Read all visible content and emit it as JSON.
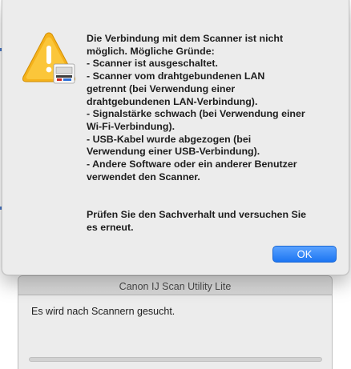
{
  "alert": {
    "icon": "warning-scanner-icon",
    "message_lines": [
      "Die Verbindung mit dem Scanner ist nicht",
      "möglich. Mögliche Gründe:",
      "- Scanner ist ausgeschaltet.",
      "- Scanner vom drahtgebundenen LAN",
      "getrennt (bei Verwendung einer",
      "drahtgebundenen LAN-Verbindung).",
      "- Signalstärke schwach (bei Verwendung einer",
      "Wi-Fi-Verbindung).",
      "- USB-Kabel wurde abgezogen (bei",
      "Verwendung einer USB-Verbindung).",
      "- Andere Software oder ein anderer Benutzer",
      "verwendet den Scanner."
    ],
    "instruction_lines": [
      "Prüfen Sie den Sachverhalt und versuchen Sie",
      "es erneut."
    ],
    "ok_label": "OK"
  },
  "window": {
    "title": "Canon IJ Scan Utility Lite",
    "status": "Es wird nach Scannern gesucht.",
    "progress": 0
  },
  "colors": {
    "accent": "#1c75f2",
    "warning": "#f5b21b"
  }
}
